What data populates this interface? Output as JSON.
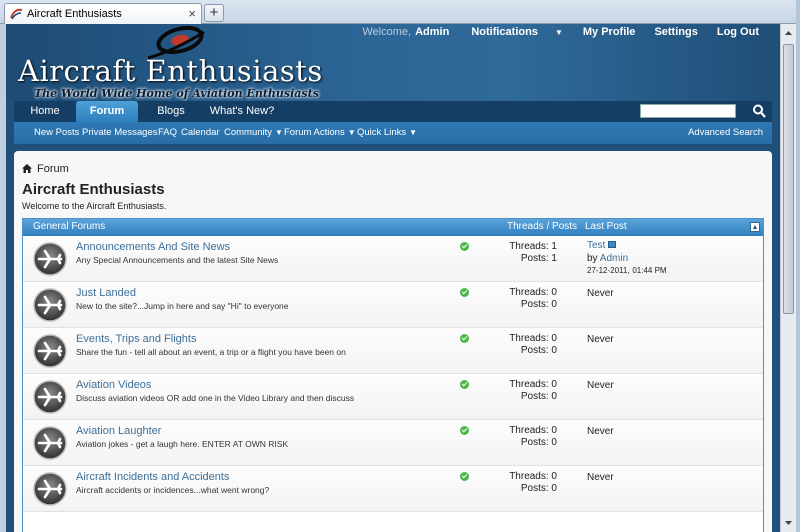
{
  "browser": {
    "tab_title": "Aircraft Enthusiasts",
    "close_glyph": "×",
    "new_tab_glyph": "+"
  },
  "header": {
    "welcome": "Welcome,",
    "user": "Admin",
    "notifications": "Notifications",
    "my_profile": "My Profile",
    "settings": "Settings",
    "logout": "Log Out",
    "site_title": "Aircraft Enthusiasts",
    "tagline": "The World Wide Home of Aviation Enthusiasts"
  },
  "nav": {
    "tabs": [
      {
        "label": "Home"
      },
      {
        "label": "Forum"
      },
      {
        "label": "Blogs"
      },
      {
        "label": "What's New?"
      }
    ]
  },
  "subnav": {
    "items": [
      {
        "label": "New Posts"
      },
      {
        "label": "Private Messages"
      },
      {
        "label": "FAQ"
      },
      {
        "label": "Calendar"
      },
      {
        "label": "Community"
      },
      {
        "label": "Forum Actions"
      },
      {
        "label": "Quick Links"
      }
    ],
    "advanced_search": "Advanced Search"
  },
  "main": {
    "breadcrumb": "Forum",
    "title": "Aircraft Enthusiasts",
    "description": "Welcome to the Aircraft Enthusiasts.",
    "block": {
      "title": "General Forums",
      "col_threads_posts": "Threads / Posts",
      "col_last_post": "Last Post"
    },
    "forums": [
      {
        "title": "Announcements And Site News",
        "desc": "Any Special Announcements and the latest Site News",
        "threads": "Threads: 1",
        "posts": "Posts: 1",
        "last_title": "Test",
        "last_by": "by",
        "last_user": "Admin",
        "last_date": "27-12-2011,",
        "last_time": "01:44 PM"
      },
      {
        "title": "Just Landed",
        "desc": "New to the site?...Jump in here and say \"Hi\" to everyone",
        "threads": "Threads: 0",
        "posts": "Posts: 0",
        "last": "Never"
      },
      {
        "title": "Events, Trips and Flights",
        "desc": "Share the fun - tell all about an event, a trip or a flight you have been on",
        "threads": "Threads: 0",
        "posts": "Posts: 0",
        "last": "Never"
      },
      {
        "title": "Aviation Videos",
        "desc": "Discuss aviation videos OR add one in the Video Library and then discuss",
        "threads": "Threads: 0",
        "posts": "Posts: 0",
        "last": "Never"
      },
      {
        "title": "Aviation Laughter",
        "desc": "Aviation jokes - get a laugh here. ENTER AT OWN RISK",
        "threads": "Threads: 0",
        "posts": "Posts: 0",
        "last": "Never"
      },
      {
        "title": "Aircraft Incidents and Accidents",
        "desc": "Aircraft accidents or incidences...what went wrong?",
        "threads": "Threads: 0",
        "posts": "Posts: 0",
        "last": "Never"
      }
    ]
  },
  "colors": {
    "header_blue": "#2b6595",
    "nav_dark": "#143e63",
    "link_blue": "#3e6f99",
    "status_green": "#4cb848"
  },
  "icons": {
    "forum_row": "airplane-icon",
    "status": "checkmark-icon",
    "breadcrumb": "home-icon",
    "search": "search-icon"
  }
}
